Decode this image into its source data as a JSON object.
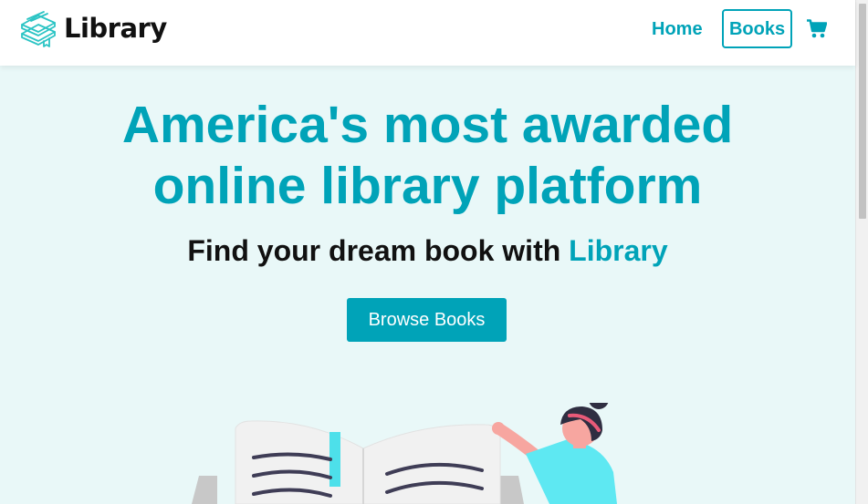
{
  "navbar": {
    "logo_text": "Library",
    "logo_icon": "books-stack-icon",
    "links": [
      {
        "label": "Home"
      },
      {
        "label": "Books"
      }
    ],
    "cart_icon": "shopping-cart-icon"
  },
  "hero": {
    "title_line1": "America's most awarded",
    "title_line2": "online library platform",
    "subtitle_prefix": "Find your dream book with ",
    "subtitle_brand": "Library",
    "cta_label": "Browse Books",
    "illustration": "person-reading-open-book-illustration"
  },
  "colors": {
    "brand": "#00a3b8",
    "hero_background": "#e9f8f8",
    "text_dark": "#111111",
    "navbar_background": "#ffffff"
  }
}
